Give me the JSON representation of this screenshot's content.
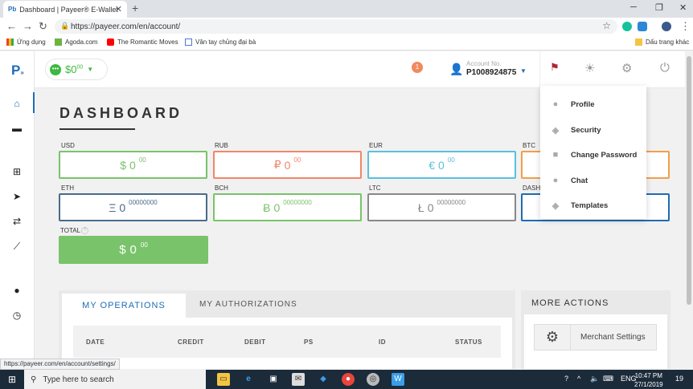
{
  "browser": {
    "tab_title": "Dashboard | Payeer® E-Wallet",
    "tab_favicon": "Pb",
    "url": "https://payeer.com/en/account/",
    "bookmarks": [
      {
        "label": "Ứng dụng",
        "icon": "apps-grid-icon"
      },
      {
        "label": "Agoda.com",
        "icon": "agoda-icon"
      },
      {
        "label": "The Romantic Moves",
        "icon": "youtube-icon"
      },
      {
        "label": "Vân tay chủng đại bà",
        "icon": "page-icon"
      }
    ],
    "other_bookmarks": "Dấu trang khác",
    "status_url": "https://payeer.com/en/account/settings/"
  },
  "header": {
    "balance": "$0",
    "balance_cents": "00",
    "notifications": "1",
    "account_label": "Account No.",
    "account_no": "P1008924875"
  },
  "dashboard": {
    "title": "DASHBOARD",
    "currencies": [
      {
        "code": "USD",
        "symbol": "$",
        "value": "0",
        "decimals": "00",
        "color": "#79c36a"
      },
      {
        "code": "RUB",
        "symbol": "₽",
        "value": "0",
        "decimals": "00",
        "color": "#f0876a"
      },
      {
        "code": "EUR",
        "symbol": "€",
        "value": "0",
        "decimals": "00",
        "color": "#5bc0de"
      },
      {
        "code": "BTC",
        "symbol": "",
        "value": "",
        "decimals": "",
        "color": "#f0a04b"
      },
      {
        "code": "ETH",
        "symbol": "Ξ",
        "value": "0",
        "decimals": "00000000",
        "color": "#4a6b8a"
      },
      {
        "code": "BCH",
        "symbol": "Ƀ",
        "value": "0",
        "decimals": "00000000",
        "color": "#79c36a"
      },
      {
        "code": "LTC",
        "symbol": "Ł",
        "value": "0",
        "decimals": "00000000",
        "color": "#888888"
      },
      {
        "code": "DASH",
        "symbol": "",
        "value": "",
        "decimals": "",
        "color": "#1f6cb5"
      }
    ],
    "total_label": "TOTAL",
    "total_symbol": "$",
    "total_value": "0",
    "total_decimals": "00"
  },
  "operations": {
    "tab_active": "MY OPERATIONS",
    "tab_other": "MY AUTHORIZATIONS",
    "columns": [
      "DATE",
      "CREDIT",
      "DEBIT",
      "PS",
      "ID",
      "STATUS"
    ]
  },
  "more_actions": {
    "title": "MORE ACTIONS",
    "button": "Merchant Settings"
  },
  "settings_menu": {
    "items": [
      {
        "label": "Profile",
        "icon": "user-icon"
      },
      {
        "label": "Security",
        "icon": "shield-icon"
      },
      {
        "label": "Change Password",
        "icon": "lock-icon"
      },
      {
        "label": "Chat",
        "icon": "chat-icon"
      },
      {
        "label": "Templates",
        "icon": "template-icon"
      }
    ]
  },
  "taskbar": {
    "search_placeholder": "Type here to search",
    "language": "ENG",
    "time": "10:47 PM",
    "date": "27/1/2019",
    "notification_count": "19"
  },
  "colors": {
    "brand_blue": "#1f6cb5",
    "green": "#3cb93f",
    "total_green": "#79c36a"
  }
}
